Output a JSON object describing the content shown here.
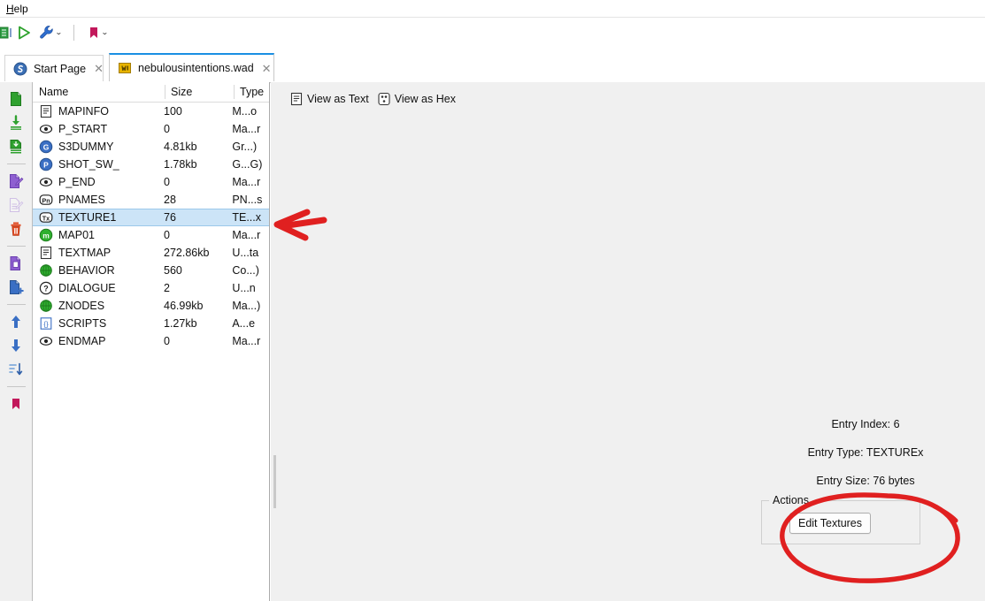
{
  "menubar": {
    "items": [
      {
        "label": "Help",
        "accel": "H"
      }
    ]
  },
  "toolbar": {
    "buttons": [
      {
        "name": "map-editor-icon",
        "label": ""
      },
      {
        "name": "run-icon",
        "label": ""
      },
      {
        "name": "tools-icon",
        "label": ""
      },
      {
        "name": "bookmark-icon",
        "label": ""
      }
    ],
    "caret": "⌄"
  },
  "tabs": [
    {
      "label": "Start Page",
      "icon": "slade-logo-icon",
      "close": "✕",
      "active": false
    },
    {
      "label": "nebulousintentions.wad",
      "icon": "wad-archive-icon",
      "close": "✕",
      "active": true
    }
  ],
  "rail": {
    "groups": [
      [
        {
          "name": "new-entry-icon"
        },
        {
          "name": "import-entry-icon"
        },
        {
          "name": "export-entry-icon"
        }
      ],
      [
        {
          "name": "rename-entry-icon"
        },
        {
          "name": "edit-entry-disabled-icon"
        },
        {
          "name": "delete-entry-icon"
        }
      ],
      [
        {
          "name": "duplicate-entry-icon"
        },
        {
          "name": "add-entry-icon"
        }
      ],
      [
        {
          "name": "move-up-icon"
        },
        {
          "name": "move-down-icon"
        },
        {
          "name": "sort-entries-icon"
        }
      ],
      [
        {
          "name": "bookmark-entry-icon"
        }
      ]
    ]
  },
  "entry_list": {
    "columns": [
      "Name",
      "Size",
      "Type"
    ],
    "rows": [
      {
        "name": "MAPINFO",
        "size": "100",
        "type": "M...o",
        "icon": "text-entry-icon",
        "selected": false
      },
      {
        "name": "P_START",
        "size": "0",
        "type": "Ma...r",
        "icon": "marker-entry-icon",
        "selected": false
      },
      {
        "name": "S3DUMMY",
        "size": "4.81kb",
        "type": "Gr...)",
        "icon": "gfx-entry-icon",
        "selected": false
      },
      {
        "name": "SHOT_SW_",
        "size": "1.78kb",
        "type": "G...G)",
        "icon": "patch-entry-icon",
        "selected": false
      },
      {
        "name": "P_END",
        "size": "0",
        "type": "Ma...r",
        "icon": "marker-entry-icon",
        "selected": false
      },
      {
        "name": "PNAMES",
        "size": "28",
        "type": "PN...s",
        "icon": "pnames-entry-icon",
        "selected": false
      },
      {
        "name": "TEXTURE1",
        "size": "76",
        "type": "TE...x",
        "icon": "texturex-entry-icon",
        "selected": true
      },
      {
        "name": "MAP01",
        "size": "0",
        "type": "Ma...r",
        "icon": "map-entry-icon",
        "selected": false
      },
      {
        "name": "TEXTMAP",
        "size": "272.86kb",
        "type": "U...ta",
        "icon": "text-entry-icon",
        "selected": false
      },
      {
        "name": "BEHAVIOR",
        "size": "560",
        "type": "Co...)",
        "icon": "compiled-entry-icon",
        "selected": false
      },
      {
        "name": "DIALOGUE",
        "size": "2",
        "type": "U...n",
        "icon": "unknown-entry-icon",
        "selected": false
      },
      {
        "name": "ZNODES",
        "size": "46.99kb",
        "type": "Ma...)",
        "icon": "compiled-entry-icon",
        "selected": false
      },
      {
        "name": "SCRIPTS",
        "size": "1.27kb",
        "type": "A...e",
        "icon": "script-entry-icon",
        "selected": false
      },
      {
        "name": "ENDMAP",
        "size": "0",
        "type": "Ma...r",
        "icon": "marker-entry-icon",
        "selected": false
      }
    ]
  },
  "view_toolbar": {
    "buttons": [
      {
        "label": "View as Text",
        "icon": "text-view-icon"
      },
      {
        "label": "View as Hex",
        "icon": "hex-view-icon"
      }
    ]
  },
  "info_panel": {
    "entry_index": "Entry Index: 6",
    "entry_type": "Entry Type: TEXTUREx",
    "entry_size": "Entry Size: 76 bytes",
    "actions_title": "Actions",
    "edit_textures_label": "Edit Textures"
  },
  "annotations": {
    "arrow": {
      "name": "red-arrow-annotation",
      "color": "#e02020"
    },
    "circle": {
      "name": "red-circle-annotation",
      "color": "#e02020"
    }
  },
  "colors": {
    "accent_blue": "#1a8fe3",
    "selection_blue": "#cce4f7",
    "panel_gray": "#f0f0f0",
    "annotation_red": "#e02020"
  }
}
